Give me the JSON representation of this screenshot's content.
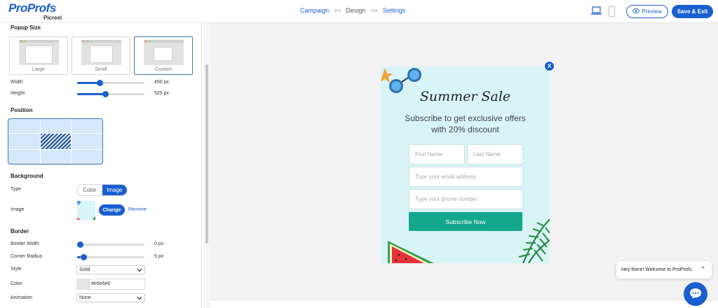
{
  "header": {
    "logo_main": "ProProfs",
    "logo_sub": "Picreel",
    "steps": [
      {
        "label": "Campaign"
      },
      {
        "label": "Design"
      },
      {
        "label": "Settings"
      }
    ],
    "separator": ">>",
    "preview_label": "Preview",
    "save_label": "Save & Exit"
  },
  "sidebar": {
    "popup_size": {
      "title": "Popup Size",
      "options": [
        {
          "label": "Large",
          "selected": false
        },
        {
          "label": "Small",
          "selected": false
        },
        {
          "label": "Custom",
          "selected": true
        }
      ],
      "width_label": "Width",
      "width_value": "450 px",
      "width_fraction": 0.33,
      "height_label": "Height",
      "height_value": "525 px",
      "height_fraction": 0.42
    },
    "position": {
      "title": "Position",
      "selected": "center"
    },
    "background": {
      "title": "Background",
      "type_label": "Type",
      "type_options": [
        "Color",
        "Image"
      ],
      "type_selected": "Image",
      "image_label": "Image",
      "change_label": "Change",
      "remove_label": "Remove"
    },
    "border": {
      "title": "Border",
      "width_label": "Border Width",
      "width_value": "0 px",
      "width_fraction": 0.0,
      "radius_label": "Corner Radius",
      "radius_value": "5 px",
      "radius_fraction": 0.05,
      "style_label": "Style",
      "style_value": "Solid",
      "color_label": "Color",
      "color_value": "#e6e6e6",
      "animation_label": "Animation",
      "animation_value": "None"
    }
  },
  "popup": {
    "close_label": "X",
    "title": "Summer Sale",
    "subtitle": "Subscribe to get exclusive offers with 20% discount",
    "first_name_placeholder": "First Name",
    "last_name_placeholder": "Last Name",
    "email_placeholder": "Type your email address",
    "phone_placeholder": "Type your phone number",
    "submit_label": "Subscribe Now",
    "background_color": "#d9f4f7",
    "button_color": "#13a88d"
  },
  "chat": {
    "greeting": "Hey there! Welcome to ProProfs.",
    "close_label": "×"
  },
  "colors": {
    "accent": "#1a5fcf"
  }
}
